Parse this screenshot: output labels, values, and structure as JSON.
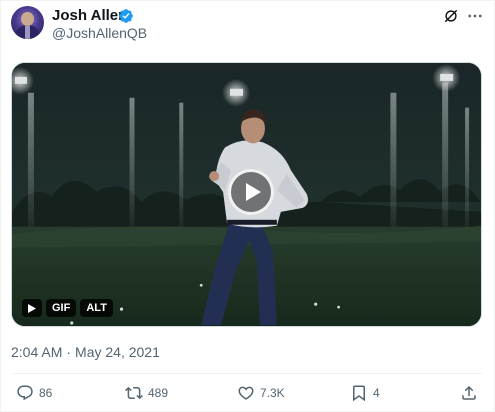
{
  "author": {
    "display_name": "Josh Allen",
    "handle": "@JoshAllenQB",
    "verified": true
  },
  "media": {
    "type": "gif",
    "badges": {
      "gif": "GIF",
      "alt": "ALT"
    }
  },
  "timestamp": {
    "time": "2:04 AM",
    "separator": "·",
    "date": "May 24, 2021"
  },
  "actions": {
    "replies": "86",
    "retweets": "489",
    "likes": "7.3K",
    "bookmarks": "4"
  },
  "colors": {
    "verified": "#1d9bf0",
    "secondary_text": "#536471",
    "divider": "#eff3f4"
  },
  "icons": [
    "grok-icon",
    "more-icon",
    "verified-badge-icon",
    "play-icon",
    "reply-icon",
    "retweet-icon",
    "like-icon",
    "bookmark-icon",
    "share-icon"
  ]
}
